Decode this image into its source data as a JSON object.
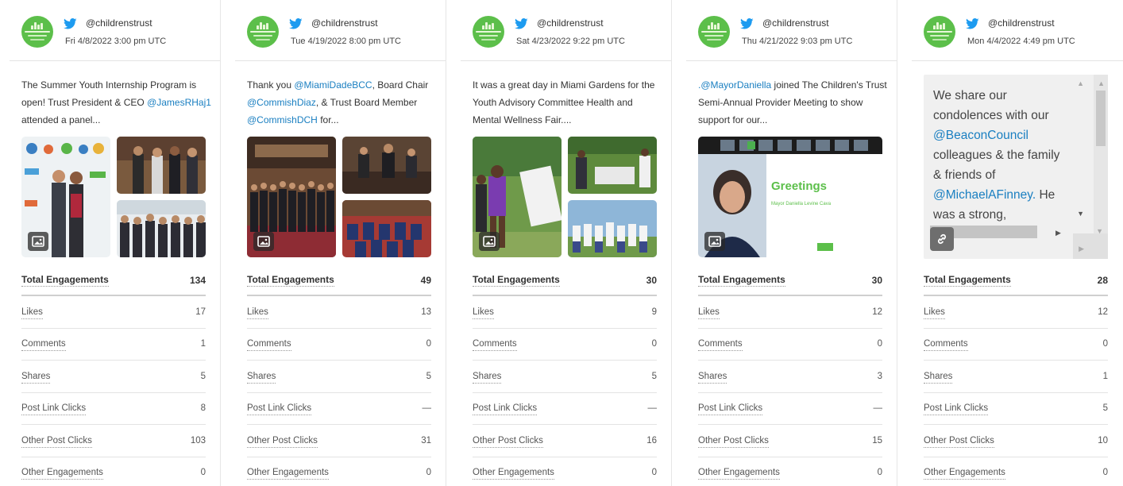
{
  "posts": [
    {
      "handle": "@childrenstrust",
      "date": "Fri 4/8/2022 3:00 pm UTC",
      "text": [
        {
          "t": "The Summer Youth Internship Program is open! Trust President & CEO ",
          "m": false
        },
        {
          "t": "@JamesRHaj1",
          "m": true
        },
        {
          "t": " attended a panel...",
          "m": false
        }
      ],
      "stats": [
        {
          "label": "Total Engagements",
          "value": "134"
        },
        {
          "label": "Likes",
          "value": "17"
        },
        {
          "label": "Comments",
          "value": "1"
        },
        {
          "label": "Shares",
          "value": "5"
        },
        {
          "label": "Post Link Clicks",
          "value": "8"
        },
        {
          "label": "Other Post Clicks",
          "value": "103"
        },
        {
          "label": "Other Engagements",
          "value": "0"
        }
      ]
    },
    {
      "handle": "@childrenstrust",
      "date": "Tue 4/19/2022 8:00 pm UTC",
      "text": [
        {
          "t": "Thank you ",
          "m": false
        },
        {
          "t": "@MiamiDadeBCC",
          "m": true
        },
        {
          "t": ", Board Chair ",
          "m": false
        },
        {
          "t": "@CommishDiaz",
          "m": true
        },
        {
          "t": ", & Trust Board Member ",
          "m": false
        },
        {
          "t": "@CommishDCH",
          "m": true
        },
        {
          "t": " for...",
          "m": false
        }
      ],
      "stats": [
        {
          "label": "Total Engagements",
          "value": "49"
        },
        {
          "label": "Likes",
          "value": "13"
        },
        {
          "label": "Comments",
          "value": "0"
        },
        {
          "label": "Shares",
          "value": "5"
        },
        {
          "label": "Post Link Clicks",
          "value": "—"
        },
        {
          "label": "Other Post Clicks",
          "value": "31"
        },
        {
          "label": "Other Engagements",
          "value": "0"
        }
      ]
    },
    {
      "handle": "@childrenstrust",
      "date": "Sat 4/23/2022 9:22 pm UTC",
      "text": [
        {
          "t": "It was a great day in Miami Gardens for the Youth Advisory Committee Health and Mental Wellness Fair....",
          "m": false
        }
      ],
      "stats": [
        {
          "label": "Total Engagements",
          "value": "30"
        },
        {
          "label": "Likes",
          "value": "9"
        },
        {
          "label": "Comments",
          "value": "0"
        },
        {
          "label": "Shares",
          "value": "5"
        },
        {
          "label": "Post Link Clicks",
          "value": "—"
        },
        {
          "label": "Other Post Clicks",
          "value": "16"
        },
        {
          "label": "Other Engagements",
          "value": "0"
        }
      ]
    },
    {
      "handle": "@childrenstrust",
      "date": "Thu 4/21/2022 9:03 pm UTC",
      "text": [
        {
          "t": ".@MayorDaniella",
          "m": true
        },
        {
          "t": " joined The Children's Trust Semi-Annual Provider Meeting to show support for our...",
          "m": false
        }
      ],
      "slide": {
        "title": "Greetings",
        "subtitle": "Mayor Daniella Levine Cava"
      },
      "stats": [
        {
          "label": "Total Engagements",
          "value": "30"
        },
        {
          "label": "Likes",
          "value": "12"
        },
        {
          "label": "Comments",
          "value": "0"
        },
        {
          "label": "Shares",
          "value": "3"
        },
        {
          "label": "Post Link Clicks",
          "value": "—"
        },
        {
          "label": "Other Post Clicks",
          "value": "15"
        },
        {
          "label": "Other Engagements",
          "value": "0"
        }
      ]
    },
    {
      "handle": "@childrenstrust",
      "date": "Mon 4/4/2022 4:49 pm UTC",
      "embed_text": [
        {
          "t": "We share our condolences with our ",
          "m": false
        },
        {
          "t": "@BeaconCouncil",
          "m": true
        },
        {
          "t": " colleagues & the family & friends of ",
          "m": false
        },
        {
          "t": "@MichaelAFinney.",
          "m": true
        },
        {
          "t": " He was a strong,",
          "m": false
        }
      ],
      "stats": [
        {
          "label": "Total Engagements",
          "value": "28"
        },
        {
          "label": "Likes",
          "value": "12"
        },
        {
          "label": "Comments",
          "value": "0"
        },
        {
          "label": "Shares",
          "value": "1"
        },
        {
          "label": "Post Link Clicks",
          "value": "5"
        },
        {
          "label": "Other Post Clicks",
          "value": "10"
        },
        {
          "label": "Other Engagements",
          "value": "0"
        }
      ]
    }
  ],
  "icons": {
    "network": "twitter-icon",
    "media": "image-icon",
    "link": "link-icon"
  },
  "colors": {
    "twitter": "#1d9bf0",
    "mention": "#1a7fc1",
    "avatar": "#5cbf4a"
  }
}
